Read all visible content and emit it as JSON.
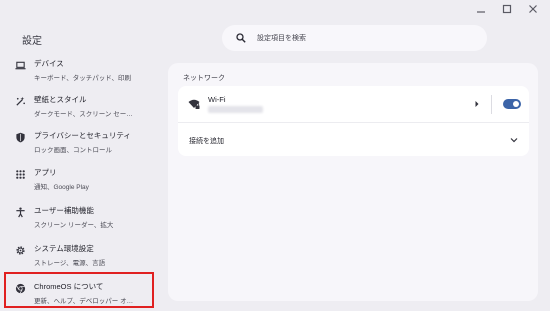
{
  "app": {
    "title": "設定"
  },
  "search": {
    "placeholder": "設定項目を検索"
  },
  "sidebar": {
    "items": [
      {
        "title": "デバイス",
        "subtitle": "キーボード、タッチパッド、印刷",
        "icon": "laptop-icon"
      },
      {
        "title": "壁紙とスタイル",
        "subtitle": "ダークモード、スクリーン セー…",
        "icon": "palette-icon"
      },
      {
        "title": "プライバシーとセキュリティ",
        "subtitle": "ロック画面、コントロール",
        "icon": "shield-icon"
      },
      {
        "title": "アプリ",
        "subtitle": "通知、Google Play",
        "icon": "apps-grid-icon"
      },
      {
        "title": "ユーザー補助機能",
        "subtitle": "スクリーン リーダー、拡大",
        "icon": "accessibility-icon"
      },
      {
        "title": "システム環境設定",
        "subtitle": "ストレージ、電源、言語",
        "icon": "gear-icon"
      },
      {
        "title": "ChromeOS について",
        "subtitle": "更新、ヘルプ、デベロッパー オ…",
        "icon": "chromeos-icon"
      }
    ]
  },
  "network": {
    "heading": "ネットワーク",
    "wifi": {
      "label": "Wi-Fi",
      "enabled": true
    },
    "add_connection": "接続を追加"
  },
  "colors": {
    "accent": "#3c64a8",
    "highlight": "#e02020",
    "background": "#eeedf2"
  }
}
